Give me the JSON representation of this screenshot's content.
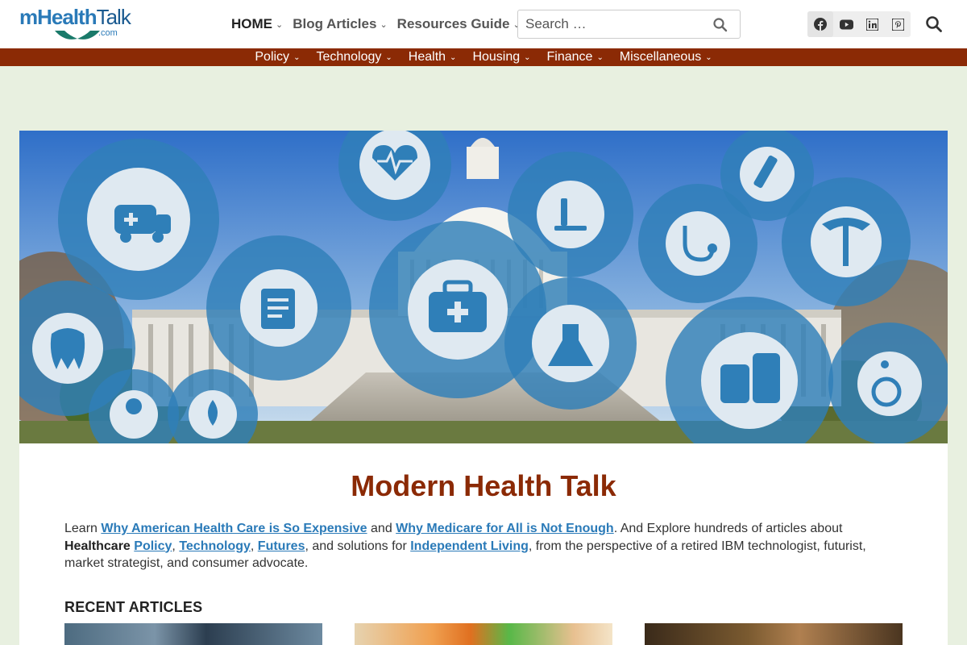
{
  "header": {
    "logo": {
      "m": "m",
      "health": "Health",
      "talk": "Talk",
      "com": ".com"
    },
    "nav": [
      {
        "label": "HOME"
      },
      {
        "label": "Blog Articles"
      },
      {
        "label": "Resources Guide"
      }
    ],
    "search": {
      "placeholder": "Search …"
    },
    "social": [
      "facebook-icon",
      "youtube-icon",
      "linkedin-icon",
      "pinterest-icon"
    ]
  },
  "subnav": [
    {
      "label": "Policy"
    },
    {
      "label": "Technology"
    },
    {
      "label": "Health"
    },
    {
      "label": "Housing"
    },
    {
      "label": "Finance"
    },
    {
      "label": "Miscellaneous"
    }
  ],
  "colors": {
    "brand_blue": "#2a7ab8",
    "brand_red": "#8b2a05",
    "page_bg": "#e8f0e0"
  },
  "content": {
    "title": "Modern Health Talk",
    "intro": {
      "t1": "Learn ",
      "link1": "Why American Health Care is So Expensive",
      "t2": " and ",
      "link2": "Why Medicare for All is Not Enough",
      "t3": ". And Explore hundreds of articles about ",
      "bold1": "Healthcare",
      "t4": " ",
      "link3": "Policy",
      "t5": ", ",
      "link4": "Technology",
      "t6": ", ",
      "link5": "Futures",
      "t7": ", and solutions for ",
      "link6": "Independent Living",
      "t8": ", from the perspective of a retired IBM technologist, futurist, market strategist, and consumer advocate."
    },
    "recent_heading": "RECENT ARTICLES"
  }
}
